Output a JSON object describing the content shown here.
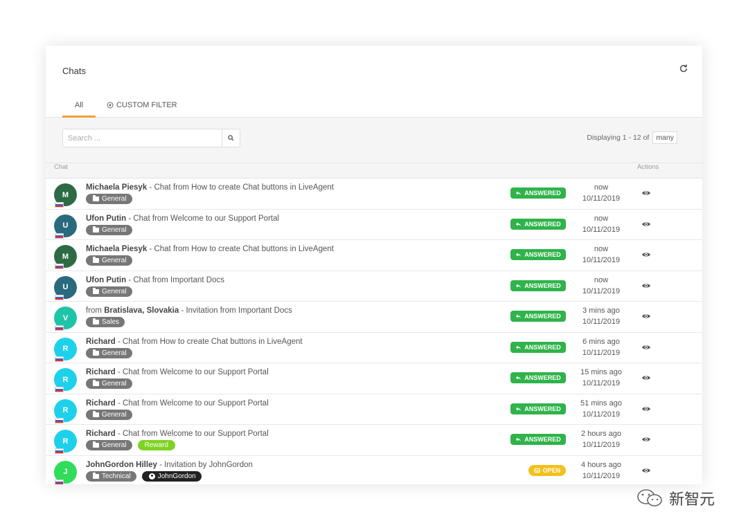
{
  "header": {
    "title": "Chats"
  },
  "tabs": {
    "all": "All",
    "custom_filter": "CUSTOM FILTER"
  },
  "search": {
    "placeholder": "Search ..."
  },
  "pager": {
    "displaying": "Displaying 1 - 12 of",
    "total": "many"
  },
  "columns": {
    "chat": "Chat",
    "actions": "Actions"
  },
  "colors": {
    "accent": "#f0a030",
    "answered": "#2fb34a",
    "open": "#f2c11b",
    "reward": "#7dd321"
  },
  "rows": [
    {
      "initial": "M",
      "avatar_color": "#2e6b45",
      "name": "Michaela Piesyk",
      "prefix": "",
      "desc": " - Chat from How to create Chat buttons in LiveAgent",
      "tags": [
        "General"
      ],
      "status": "ANSWERED",
      "time_rel": "now",
      "date": "10/11/2019"
    },
    {
      "initial": "U",
      "avatar_color": "#2a6a7e",
      "name": "Ufon Putin",
      "prefix": "",
      "desc": " - Chat from Welcome to our Support Portal",
      "tags": [
        "General"
      ],
      "status": "ANSWERED",
      "time_rel": "now",
      "date": "10/11/2019"
    },
    {
      "initial": "M",
      "avatar_color": "#2e6b45",
      "name": "Michaela Piesyk",
      "prefix": "",
      "desc": " - Chat from How to create Chat buttons in LiveAgent",
      "tags": [
        "General"
      ],
      "status": "ANSWERED",
      "time_rel": "now",
      "date": "10/11/2019"
    },
    {
      "initial": "U",
      "avatar_color": "#2a6a7e",
      "name": "Ufon Putin",
      "prefix": "",
      "desc": " - Chat from Important Docs",
      "tags": [
        "General"
      ],
      "status": "ANSWERED",
      "time_rel": "now",
      "date": "10/11/2019"
    },
    {
      "initial": "V",
      "avatar_color": "#1fc4a8",
      "name": "Bratislava, Slovakia",
      "prefix": "from ",
      "desc": " - Invitation from Important Docs",
      "tags": [
        "Sales"
      ],
      "status": "ANSWERED",
      "time_rel": "3 mins ago",
      "date": "10/11/2019"
    },
    {
      "initial": "R",
      "avatar_color": "#1ed1ea",
      "name": "Richard",
      "prefix": "",
      "desc": " - Chat from How to create Chat buttons in LiveAgent",
      "tags": [
        "General"
      ],
      "status": "ANSWERED",
      "time_rel": "6 mins ago",
      "date": "10/11/2019"
    },
    {
      "initial": "R",
      "avatar_color": "#1ed1ea",
      "name": "Richard",
      "prefix": "",
      "desc": " - Chat from Welcome to our Support Portal",
      "tags": [
        "General"
      ],
      "status": "ANSWERED",
      "time_rel": "15 mins ago",
      "date": "10/11/2019"
    },
    {
      "initial": "R",
      "avatar_color": "#1ed1ea",
      "name": "Richard",
      "prefix": "",
      "desc": " - Chat from Welcome to our Support Portal",
      "tags": [
        "General"
      ],
      "status": "ANSWERED",
      "time_rel": "51 mins ago",
      "date": "10/11/2019"
    },
    {
      "initial": "R",
      "avatar_color": "#1ed1ea",
      "name": "Richard",
      "prefix": "",
      "desc": " - Chat from Welcome to our Support Portal",
      "tags": [
        "General",
        "Reward"
      ],
      "status": "ANSWERED",
      "time_rel": "2 hours ago",
      "date": "10/11/2019"
    },
    {
      "initial": "J",
      "avatar_color": "#2fdc5c",
      "name": "JohnGordon Hilley",
      "prefix": "",
      "desc": " - Invitation by JohnGordon",
      "tags": [
        "Technical",
        "JohnGordon"
      ],
      "status": "OPEN",
      "time_rel": "4 hours ago",
      "date": "10/11/2019"
    }
  ],
  "watermark": {
    "text": "新智元"
  }
}
